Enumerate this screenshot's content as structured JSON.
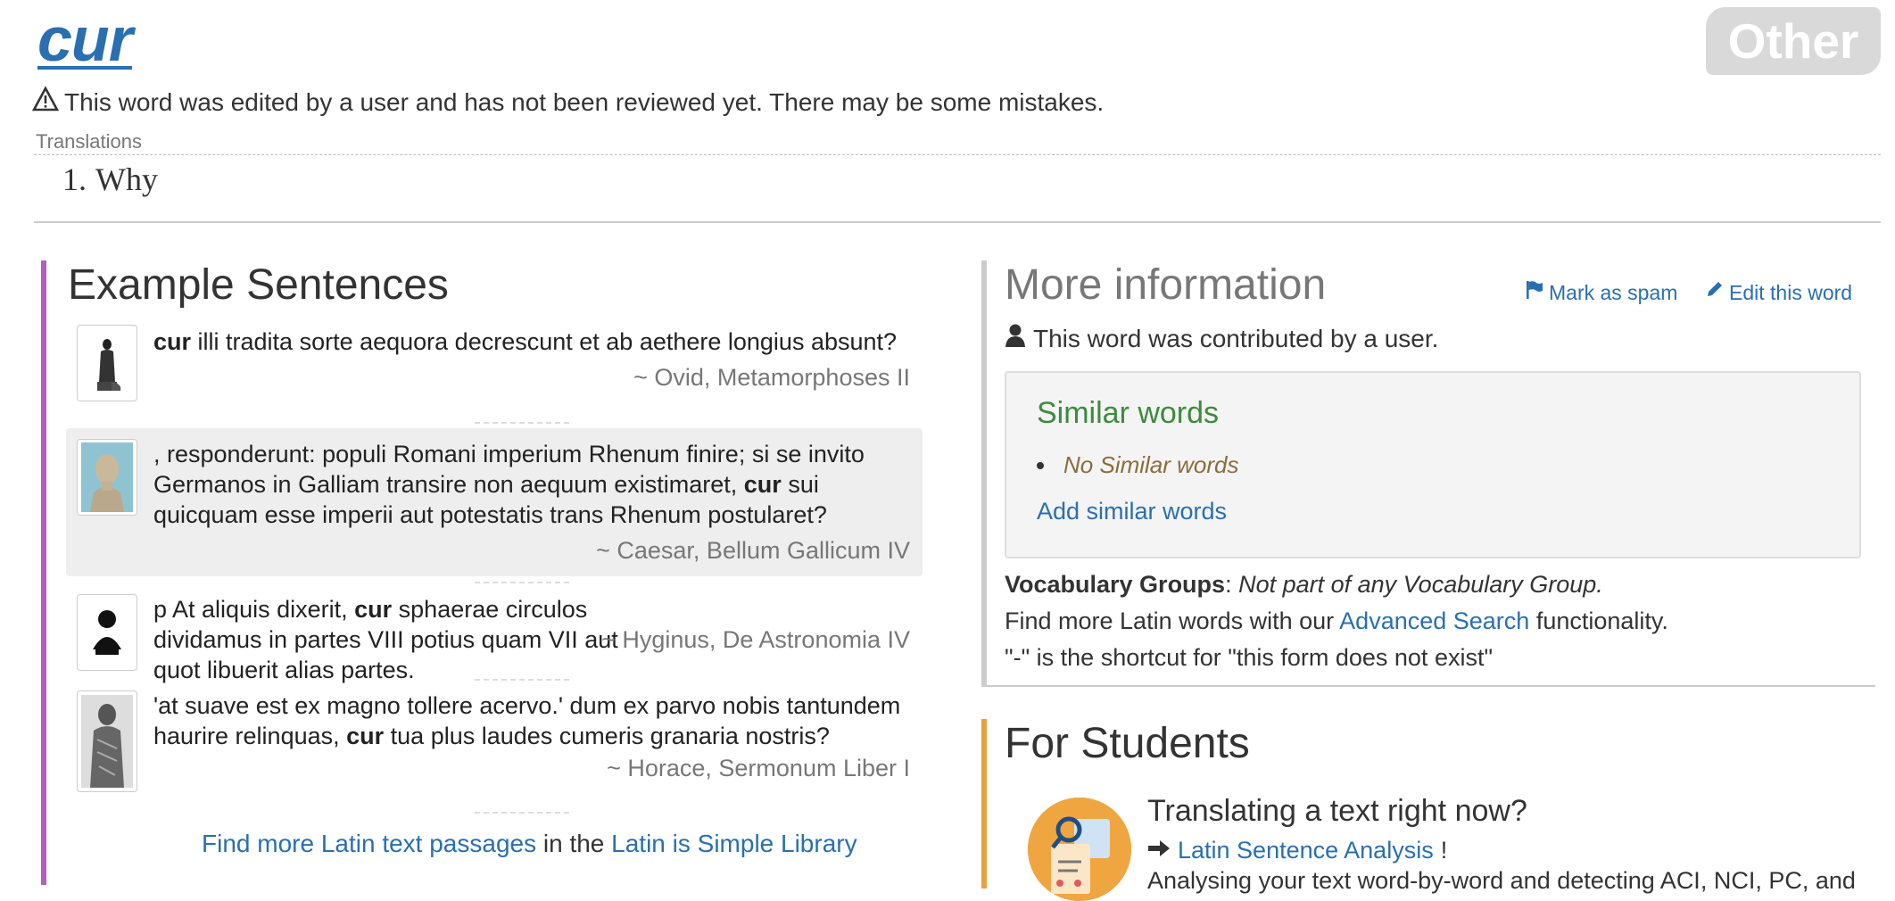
{
  "word": "cur",
  "part_of_speech": "Other",
  "warning": "This word was edited by a user and has not been reviewed yet. There may be some mistakes.",
  "translations_label": "Translations",
  "translations": [
    {
      "number": "1.",
      "text": "Why"
    }
  ],
  "examples": {
    "heading": "Example Sentences",
    "items": [
      {
        "before": "",
        "keyword": "cur",
        "after": " illi tradita sorte aequora decrescunt et ab aethere longius absunt?",
        "source": "~ Ovid, Metamorphoses II"
      },
      {
        "before": ", responderunt: populi Romani imperium Rhenum finire; si se invito Germanos in Galliam transire non aequum existimaret, ",
        "keyword": "cur",
        "after": " sui quicquam esse imperii aut potestatis trans Rhenum postularet?",
        "source": "~ Caesar, Bellum Gallicum IV"
      },
      {
        "before": "p At aliquis dixerit, ",
        "keyword": "cur",
        "after": " sphaerae circulos dividamus in partes VIII potius quam VII aut quot libuerit alias partes.",
        "source": "~ Hyginus, De Astronomia IV"
      },
      {
        "before": "'at suave est ex magno tollere acervo.' dum ex parvo nobis tantundem haurire relinquas, ",
        "keyword": "cur",
        "after": " tua plus laudes cumeris granaria nostris?",
        "source": "~ Horace, Sermonum Liber I"
      }
    ],
    "find_more_link": "Find more Latin text passages",
    "find_more_middle": " in the ",
    "library_link": "Latin is Simple Library"
  },
  "more_info": {
    "heading": "More information",
    "mark_spam": "Mark as spam",
    "edit_word": "Edit this word",
    "contributed": "This word was contributed by a user.",
    "similar_heading": "Similar words",
    "no_similar": "No Similar words",
    "add_similar": "Add similar words",
    "vocab_label": "Vocabulary Groups",
    "vocab_value": "Not part of any Vocabulary Group.",
    "adv_before": "Find more Latin words with our ",
    "adv_link": "Advanced Search",
    "adv_after": " functionality.",
    "shortcut": "\"-\" is the shortcut for \"this form does not exist\""
  },
  "students": {
    "heading": "For Students",
    "subheading": "Translating a text right now?",
    "link": "Latin Sentence Analysis",
    "link_suffix": "!",
    "description": "Analysing your text word-by-word and detecting ACI, NCI, PC, and"
  },
  "colors": {
    "link": "#2a6fb0",
    "examples_border": "#b35fbf",
    "students_border": "#e6a23c",
    "similar_heading": "#3d8b3d",
    "no_similar": "#8a6d3b"
  },
  "icons": [
    "warning-triangle-icon",
    "flag-icon",
    "pencil-icon",
    "user-icon",
    "arrow-right-icon"
  ]
}
